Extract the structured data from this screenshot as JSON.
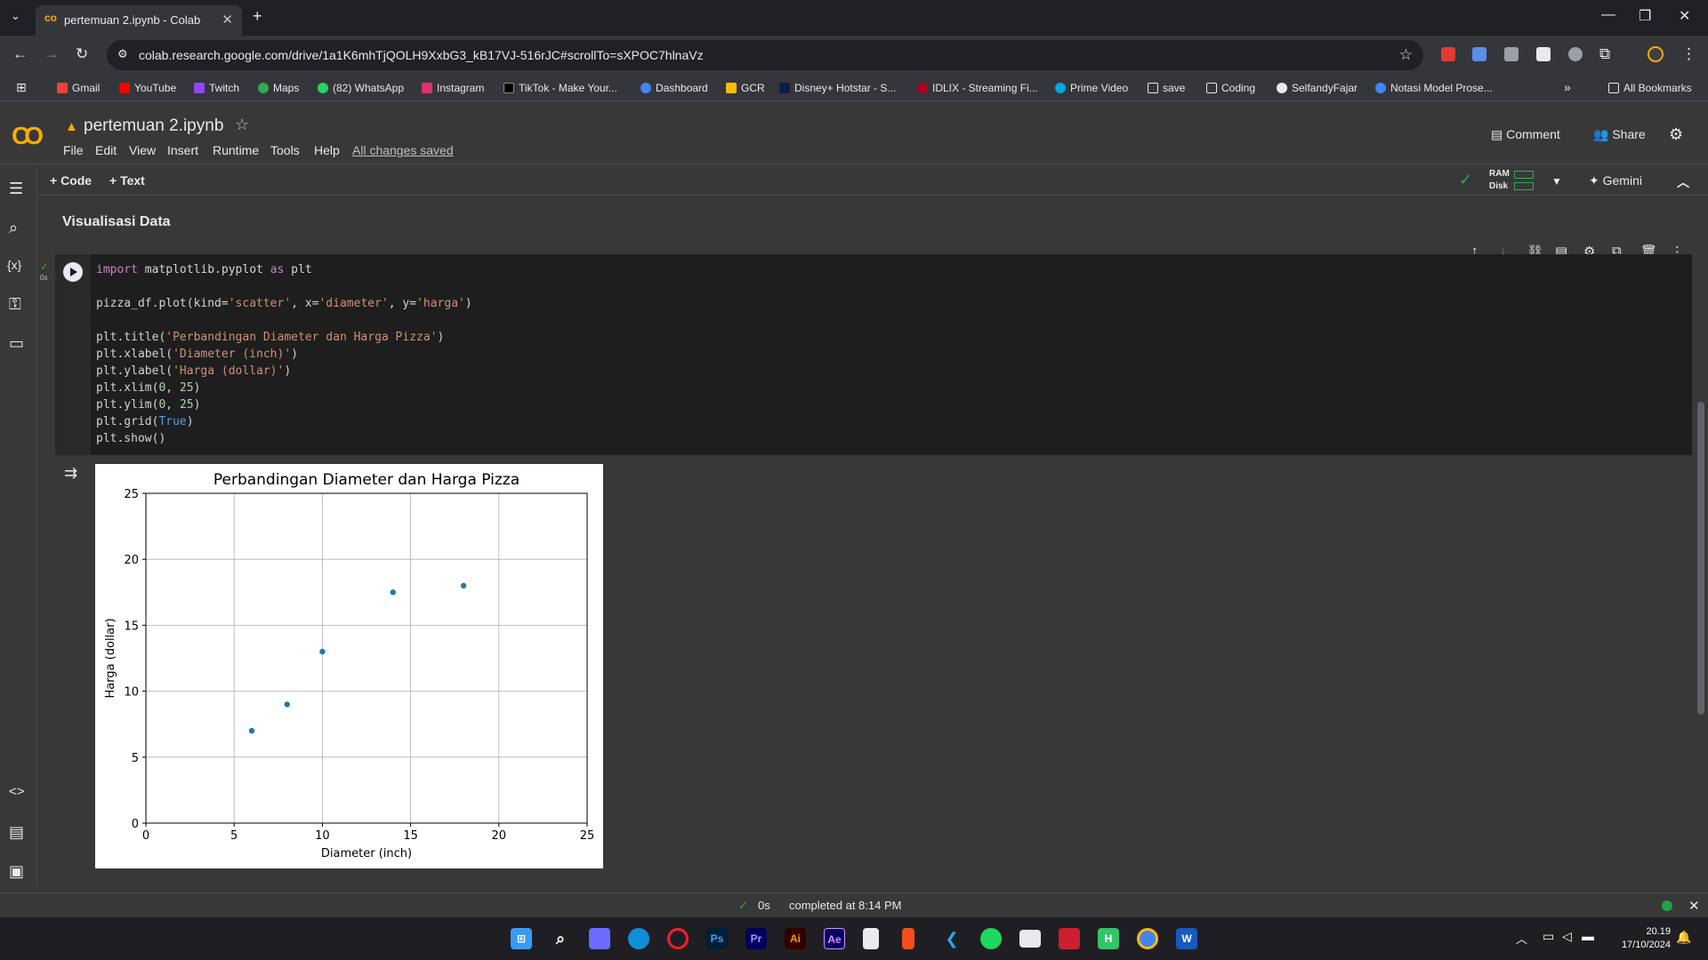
{
  "browser": {
    "tab_title": "pertemuan 2.ipynb - Colab",
    "url": "colab.research.google.com/drive/1a1K6mhTjQOLH9XxbG3_kB17VJ-516rJC#scrollTo=sXPOC7hlnaVz",
    "bookmarks": [
      "Gmail",
      "YouTube",
      "Twitch",
      "Maps",
      "(82) WhatsApp",
      "Instagram",
      "TikTok - Make Your...",
      "Dashboard",
      "GCR",
      "Disney+ Hotstar - S...",
      "IDLIX - Streaming Fi...",
      "Prime Video",
      "save",
      "Coding",
      "SelfandyFajar",
      "Notasi Model Prose..."
    ],
    "all_bookmarks": "All Bookmarks"
  },
  "colab": {
    "notebook_title": "pertemuan 2.ipynb",
    "menu": [
      "File",
      "Edit",
      "View",
      "Insert",
      "Runtime",
      "Tools",
      "Help"
    ],
    "saved_status": "All changes saved",
    "comment_label": "Comment",
    "share_label": "Share",
    "add_code": "+ Code",
    "add_text": "+ Text",
    "ram_label": "RAM",
    "disk_label": "Disk",
    "gemini_label": "Gemini",
    "section_heading": "Visualisasi Data",
    "exec_time": "0s"
  },
  "code_lines": [
    "import matplotlib.pyplot as plt",
    "",
    "pizza_df.plot(kind='scatter', x='diameter', y='harga')",
    "",
    "plt.title('Perbandingan Diameter dan Harga Pizza')",
    "plt.xlabel('Diameter (inch)')",
    "plt.ylabel('Harga (dollar)')",
    "plt.xlim(0, 25)",
    "plt.ylim(0, 25)",
    "plt.grid(True)",
    "plt.show()"
  ],
  "chart_data": {
    "type": "scatter",
    "title": "Perbandingan Diameter dan Harga Pizza",
    "xlabel": "Diameter (inch)",
    "ylabel": "Harga (dollar)",
    "xlim": [
      0,
      25
    ],
    "ylim": [
      0,
      25
    ],
    "xticks": [
      0,
      5,
      10,
      15,
      20,
      25
    ],
    "yticks": [
      0,
      5,
      10,
      15,
      20,
      25
    ],
    "grid": true,
    "points": [
      {
        "x": 6,
        "y": 7
      },
      {
        "x": 8,
        "y": 9
      },
      {
        "x": 10,
        "y": 13
      },
      {
        "x": 14,
        "y": 17.5
      },
      {
        "x": 18,
        "y": 18
      }
    ],
    "marker_color": "#1f77b4"
  },
  "status": {
    "time": "0s",
    "message": "completed at 8:14 PM"
  },
  "taskbar": {
    "time": "20.19",
    "date": "17/10/2024"
  }
}
